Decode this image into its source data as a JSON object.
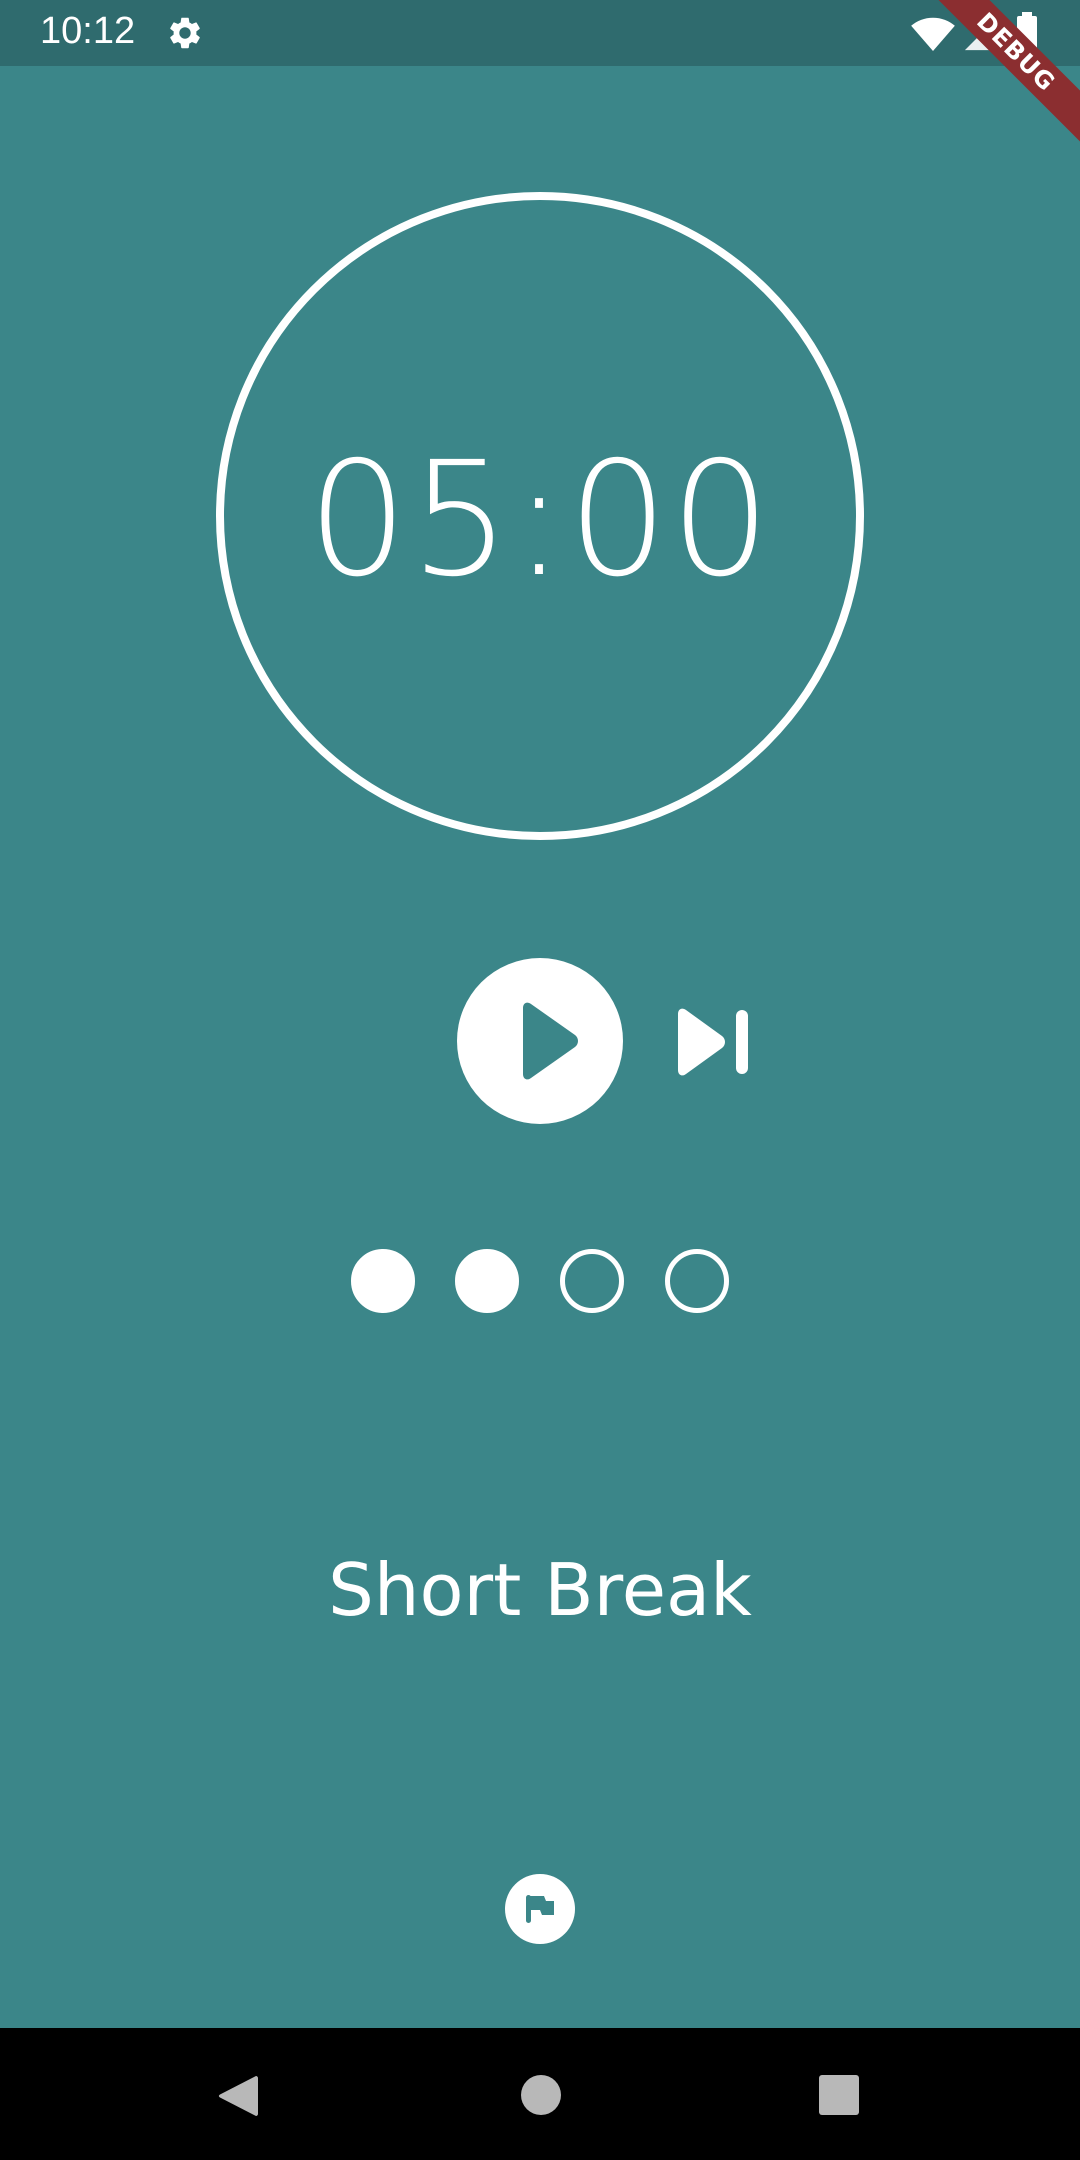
{
  "status_bar": {
    "time": "10:12",
    "icons": [
      "gear-icon",
      "wifi-icon",
      "signal-icon",
      "battery-icon"
    ]
  },
  "debug_banner": "DEBUG",
  "timer": {
    "display": "05:00"
  },
  "controls": {
    "primary": "play-icon",
    "secondary": "skip-next-icon"
  },
  "sessions": {
    "completed": 2,
    "total": 4
  },
  "mode_label": "Short Break",
  "bottom_action": "flag-icon",
  "navigation": {
    "icons": [
      "back-icon",
      "home-icon",
      "recents-icon"
    ]
  },
  "colors": {
    "background": "#3b8689",
    "status_bar": "#2f6b6e",
    "foreground": "#ffffff",
    "debug_ribbon": "#8b2e30",
    "nav_bar": "#000000"
  }
}
